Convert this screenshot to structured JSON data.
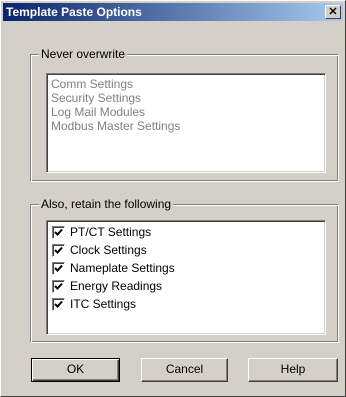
{
  "window": {
    "title": "Template Paste Options",
    "close_glyph": "✕"
  },
  "never_overwrite": {
    "label": "Never overwrite",
    "items": [
      "Comm Settings",
      "Security Settings",
      "Log Mail Modules",
      "Modbus Master Settings"
    ]
  },
  "retain": {
    "label": "Also, retain the following",
    "items": [
      {
        "label": "PT/CT Settings",
        "checked": true
      },
      {
        "label": "Clock Settings",
        "checked": true
      },
      {
        "label": "Nameplate Settings",
        "checked": true
      },
      {
        "label": "Energy Readings",
        "checked": true
      },
      {
        "label": "ITC Settings",
        "checked": true
      }
    ]
  },
  "buttons": {
    "ok": "OK",
    "cancel": "Cancel",
    "help": "Help"
  }
}
